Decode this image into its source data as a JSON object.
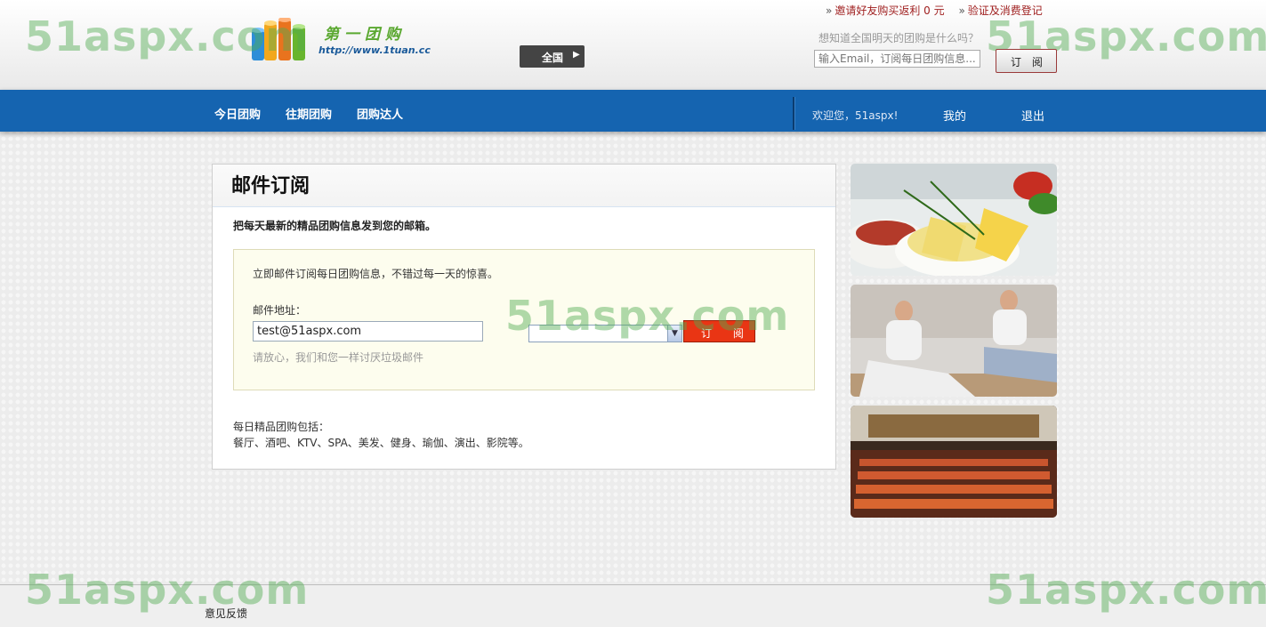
{
  "header": {
    "logo_cn": "第一团购",
    "logo_url": "http://www.1tuan.cc",
    "city_button": "全国",
    "top_links": [
      "邀请好友购买返利 0 元",
      "验证及消费登记"
    ],
    "subscribe_question": "想知道全国明天的团购是什么吗？",
    "subscribe_placeholder": "输入Email，订阅每日团购信息...",
    "subscribe_button": "订 阅"
  },
  "watermark": "51aspx.com",
  "nav": {
    "items": [
      "今日团购",
      "往期团购",
      "团购达人"
    ],
    "welcome": "欢迎您，51aspx!",
    "mine": "我的",
    "logout": "退出"
  },
  "main": {
    "title": "邮件订阅",
    "intro": "把每天最新的精品团购信息发到您的邮箱。",
    "form": {
      "lead": "立即邮件订阅每日团购信息，不错过每一天的惊喜。",
      "email_label": "邮件地址：",
      "email_value": "test@51aspx.com",
      "hint": "请放心，我们和您一样讨厌垃圾邮件",
      "city_select_value": "",
      "submit": "订 阅"
    },
    "includes_title": "每日精品团购包括：",
    "includes_list": "餐厅、酒吧、KTV、SPA、美发、健身、瑜伽、演出、影院等。"
  },
  "sidebar": {
    "images": [
      "food-image",
      "yoga-image",
      "theater-image"
    ]
  },
  "footer": {
    "feedback": "意见反馈"
  },
  "colors": {
    "nav_blue": "#1564b0",
    "order_red": "#e93514",
    "form_bg": "#fdfdee",
    "top_link_red": "#a02020"
  }
}
